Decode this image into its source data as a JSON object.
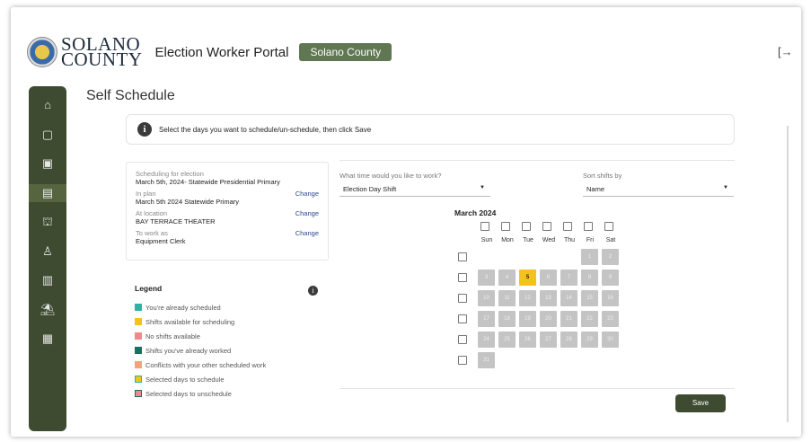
{
  "header": {
    "brand_line1": "SOLANO",
    "brand_line2": "COUNTY",
    "portal_title": "Election Worker Portal",
    "county_badge": "Solano County",
    "logout_icon": "logout-icon"
  },
  "sidebar": {
    "items": [
      {
        "name": "home-icon",
        "glyph": "⌂"
      },
      {
        "name": "calendar-icon",
        "glyph": "▢"
      },
      {
        "name": "calendar-check-icon",
        "glyph": "▣"
      },
      {
        "name": "calendar-schedule-icon",
        "glyph": "▤",
        "active": true
      },
      {
        "name": "classroom-icon",
        "glyph": "⛫"
      },
      {
        "name": "user-icon",
        "glyph": "♙"
      },
      {
        "name": "calendar-clock-icon",
        "glyph": "▥"
      },
      {
        "name": "beach-icon",
        "glyph": "⛱"
      },
      {
        "name": "building-icon",
        "glyph": "▦"
      }
    ]
  },
  "page": {
    "title": "Self Schedule",
    "info_text": "Select the days you want to schedule/un-schedule, then click Save"
  },
  "scheduling": {
    "election_label": "Scheduling for election",
    "election_value": "March 5th, 2024- Statewide Presidential Primary",
    "plan_label": "In plan",
    "plan_value": "March 5th 2024 Statewide Primary",
    "location_label": "At location",
    "location_value": "BAY TERRACE THEATER",
    "work_label": "To work as",
    "work_value": "Equipment Clerk",
    "change_label": "Change"
  },
  "legend": {
    "title": "Legend",
    "items": [
      {
        "label": "You're already scheduled",
        "color": "#2bb3a3"
      },
      {
        "label": "Shifts available for scheduling",
        "color": "#f3c21c"
      },
      {
        "label": "No shifts available",
        "color": "#f08a8a"
      },
      {
        "label": "Shifts you've already worked",
        "color": "#17715e"
      },
      {
        "label": "Conflicts with your other scheduled work",
        "color": "#f6a27a"
      },
      {
        "label": "Selected days to schedule",
        "color": "#f3c21c",
        "border": "#2bb3a3"
      },
      {
        "label": "Selected days to unschedule",
        "color": "#f08a8a",
        "border": "#17715e"
      }
    ]
  },
  "filters": {
    "work_question": "What time would you like to work?",
    "work_value": "Election Day Shift",
    "sort_label": "Sort shifts by",
    "sort_value": "Name"
  },
  "calendar": {
    "month": "March 2024",
    "weekdays": [
      "Sun",
      "Mon",
      "Tue",
      "Wed",
      "Thu",
      "Fri",
      "Sat"
    ],
    "weeks": [
      [
        null,
        null,
        null,
        null,
        null,
        1,
        2
      ],
      [
        3,
        4,
        5,
        6,
        7,
        8,
        9
      ],
      [
        10,
        11,
        12,
        13,
        14,
        15,
        16
      ],
      [
        17,
        18,
        19,
        20,
        21,
        22,
        23
      ],
      [
        24,
        25,
        26,
        27,
        28,
        29,
        30
      ],
      [
        31,
        null,
        null,
        null,
        null,
        null,
        null
      ]
    ],
    "available_days": [
      5
    ]
  },
  "actions": {
    "save_label": "Save"
  }
}
